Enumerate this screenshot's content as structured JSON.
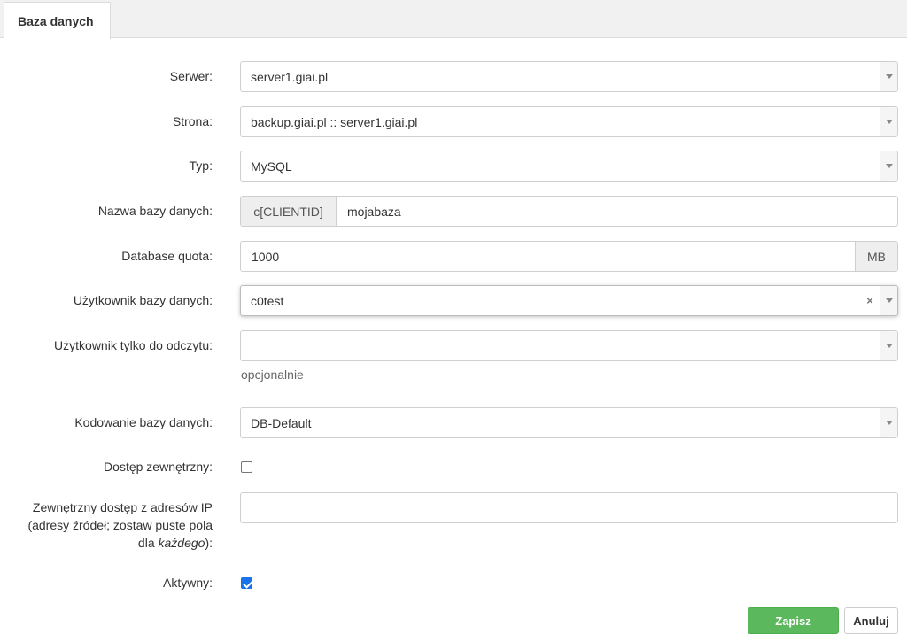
{
  "tab": {
    "label": "Baza danych"
  },
  "fields": {
    "server": {
      "label": "Serwer:",
      "value": "server1.giai.pl"
    },
    "site": {
      "label": "Strona:",
      "value": "backup.giai.pl :: server1.giai.pl"
    },
    "type": {
      "label": "Typ:",
      "value": "MySQL"
    },
    "db_name": {
      "label": "Nazwa bazy danych:",
      "prefix": "c[CLIENTID]",
      "value": "mojabaza"
    },
    "quota": {
      "label": "Database quota:",
      "value": "1000",
      "unit": "MB"
    },
    "db_user": {
      "label": "Użytkownik bazy danych:",
      "value": "c0test",
      "clear": "×"
    },
    "ro_user": {
      "label": "Użytkownik tylko do odczytu:",
      "value": "",
      "hint": "opcjonalnie"
    },
    "charset": {
      "label": "Kodowanie bazy danych:",
      "value": "DB-Default"
    },
    "remote_access": {
      "label": "Dostęp zewnętrzny:",
      "checked": false
    },
    "remote_ips": {
      "label_line1": "Zewnętrzny dostęp z adresów IP",
      "label_line2": "(adresy źródeł; zostaw puste pola",
      "label_line3_pre": "dla ",
      "label_line3_em": "każdego",
      "label_line3_post": "):",
      "value": ""
    },
    "active": {
      "label": "Aktywny:",
      "checked": true
    }
  },
  "buttons": {
    "save": "Zapisz",
    "cancel": "Anuluj"
  }
}
